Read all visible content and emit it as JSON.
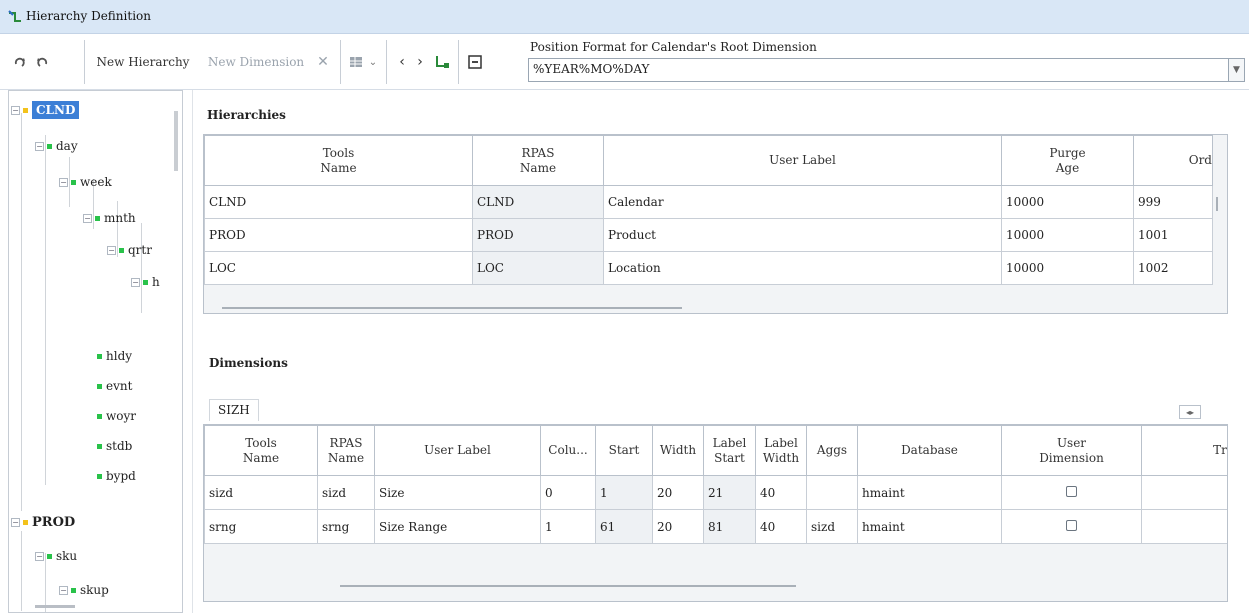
{
  "window": {
    "title": "Hierarchy Definition"
  },
  "toolbar": {
    "new_hierarchy_label": "New Hierarchy",
    "new_dimension_label": "New Dimension",
    "position_format_label": "Position Format for Calendar's Root Dimension",
    "position_format_value": "%YEAR%MO%DAY"
  },
  "tree": {
    "nodes": [
      {
        "label": "CLND"
      },
      {
        "label": "day"
      },
      {
        "label": "week"
      },
      {
        "label": "mnth"
      },
      {
        "label": "qrtr"
      },
      {
        "label": "h"
      },
      {
        "label": "hldy"
      },
      {
        "label": "evnt"
      },
      {
        "label": "woyr"
      },
      {
        "label": "stdb"
      },
      {
        "label": "bypd"
      },
      {
        "label": "PROD"
      },
      {
        "label": "sku"
      },
      {
        "label": "skup"
      }
    ]
  },
  "hierarchies": {
    "title": "Hierarchies",
    "columns": [
      "Tools\nName",
      "RPAS\nName",
      "User Label",
      "Purge\nAge",
      "Ord"
    ],
    "rows": [
      [
        "CLND",
        "CLND",
        "Calendar",
        "10000",
        "999"
      ],
      [
        "PROD",
        "PROD",
        "Product",
        "10000",
        "1001"
      ],
      [
        "LOC",
        "LOC",
        "Location",
        "10000",
        "1002"
      ]
    ]
  },
  "dimensions": {
    "title": "Dimensions",
    "tab_label": "SIZH",
    "columns": [
      "Tools\nName",
      "RPAS\nName",
      "User Label",
      "Colu...",
      "Start",
      "Width",
      "Label\nStart",
      "Label\nWidth",
      "Aggs",
      "Database",
      "User\nDimension",
      "Tra"
    ],
    "rows": [
      [
        "sizd",
        "sizd",
        "Size",
        "0",
        "1",
        "20",
        "21",
        "40",
        "",
        "hmaint",
        false,
        ""
      ],
      [
        "srng",
        "srng",
        "Size Range",
        "1",
        "61",
        "20",
        "81",
        "40",
        "sizd",
        "hmaint",
        false,
        ""
      ]
    ]
  }
}
